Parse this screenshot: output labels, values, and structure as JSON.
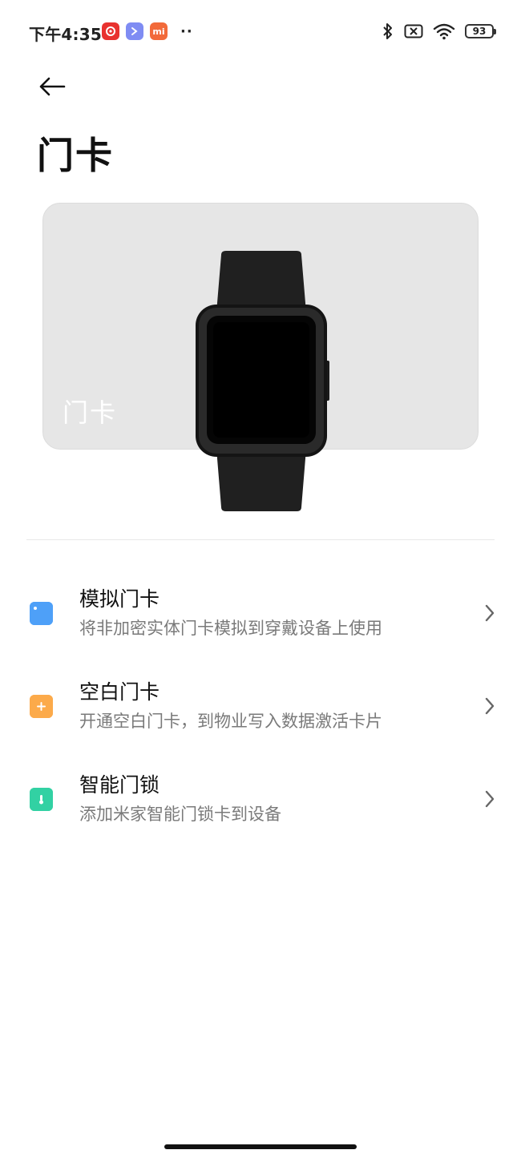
{
  "status_bar": {
    "time": "下午4:35",
    "notification_icons": [
      "netease-music-icon",
      "app-icon",
      "mi-icon"
    ],
    "mi_label": "mi",
    "more": "··",
    "battery": "93",
    "right_icons": [
      "bluetooth-icon",
      "sim-none-icon",
      "wifi-icon",
      "battery-icon"
    ]
  },
  "header": {
    "back_icon": "back-arrow-icon",
    "title": "门卡"
  },
  "hero": {
    "card_label": "门卡",
    "image": "smart-watch-image"
  },
  "list": [
    {
      "icon": "card-icon",
      "icon_color": "#4ea0f8",
      "title": "模拟门卡",
      "subtitle": "将非加密实体门卡模拟到穿戴设备上使用"
    },
    {
      "icon": "plus-card-icon",
      "icon_color": "#fcaa4a",
      "title": "空白门卡",
      "subtitle": "开通空白门卡，到物业写入数据激活卡片"
    },
    {
      "icon": "lock-icon",
      "icon_color": "#32d1a3",
      "title": "智能门锁",
      "subtitle": "添加米家智能门锁卡到设备"
    }
  ]
}
